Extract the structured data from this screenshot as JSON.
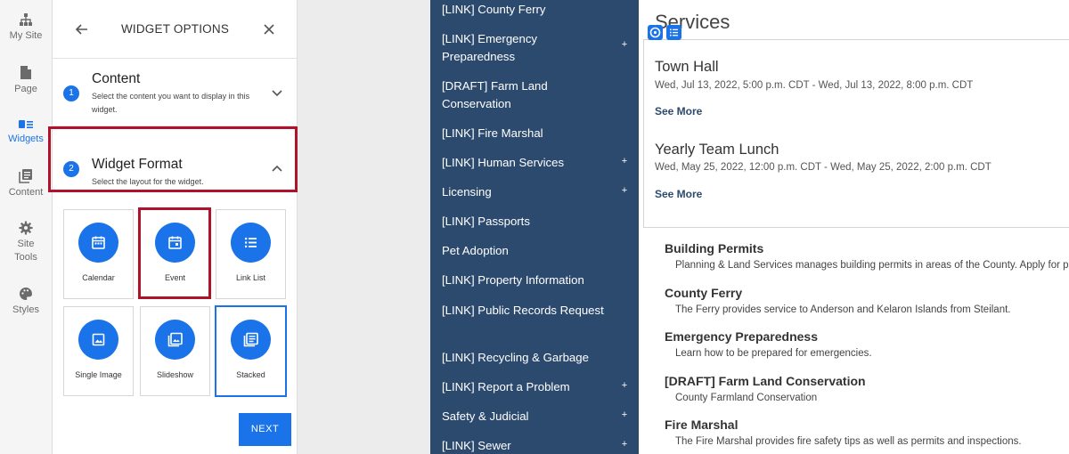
{
  "rail": {
    "items": [
      {
        "label": "My Site",
        "icon": "sitemap-icon"
      },
      {
        "label": "Page",
        "icon": "page-icon"
      },
      {
        "label": "Widgets",
        "icon": "widgets-icon"
      },
      {
        "label": "Content",
        "icon": "content-icon"
      },
      {
        "label": "Site Tools",
        "icon": "gear-icon"
      },
      {
        "label": "Styles",
        "icon": "palette-icon"
      }
    ],
    "active": "Widgets",
    "active_color": "#1a73e8"
  },
  "panel": {
    "title": "WIDGET OPTIONS",
    "steps": [
      {
        "num": "1",
        "title": "Content",
        "desc": "Select the content you want to display in this widget.",
        "state": "collapsed"
      },
      {
        "num": "2",
        "title": "Widget Format",
        "desc": "Select the layout for the widget.",
        "state": "expanded"
      }
    ],
    "formats": [
      {
        "label": "Calendar",
        "icon": "calendar-icon"
      },
      {
        "label": "Event",
        "icon": "event-icon"
      },
      {
        "label": "Link List",
        "icon": "list-icon"
      },
      {
        "label": "Single Image",
        "icon": "image-icon"
      },
      {
        "label": "Slideshow",
        "icon": "slideshow-icon"
      },
      {
        "label": "Stacked",
        "icon": "stacked-icon"
      }
    ],
    "selected_format": "Stacked",
    "next_label": "NEXT",
    "highlight_color": "#b0122b"
  },
  "nav": {
    "background": "#2c4a6e",
    "items": [
      {
        "label": "[LINK] County Ferry",
        "expandable": false
      },
      {
        "label": "[LINK] Emergency Preparedness",
        "expandable": true
      },
      {
        "label": "[DRAFT] Farm Land Conservation",
        "expandable": false
      },
      {
        "label": "[LINK] Fire Marshal",
        "expandable": false
      },
      {
        "label": "[LINK] Human Services",
        "expandable": true
      },
      {
        "label": "Licensing",
        "expandable": true
      },
      {
        "label": "[LINK] Passports",
        "expandable": false
      },
      {
        "label": "Pet Adoption",
        "expandable": false
      },
      {
        "label": "[LINK] Property Information",
        "expandable": false
      },
      {
        "label": "[LINK] Public Records Request",
        "expandable": false
      },
      {
        "label": "[LINK] Recycling & Garbage",
        "expandable": false
      },
      {
        "label": "[LINK] Report a Problem",
        "expandable": true
      },
      {
        "label": "Safety & Judicial",
        "expandable": true
      },
      {
        "label": "[LINK] Sewer",
        "expandable": true
      }
    ],
    "plus_symbol": "+"
  },
  "content": {
    "title": "Services",
    "events": [
      {
        "title": "Town Hall",
        "date": "Wed, Jul 13, 2022, 5:00 p.m. CDT - Wed, Jul 13, 2022, 8:00 p.m. CDT",
        "link": "See More"
      },
      {
        "title": "Yearly Team Lunch",
        "date": "Wed, May 25, 2022, 12:00 p.m. CDT - Wed, May 25, 2022, 2:00 p.m. CDT",
        "link": "See More"
      }
    ],
    "services": [
      {
        "name": "Building Permits",
        "desc": "Planning & Land Services manages building permits in areas of the County. Apply for p"
      },
      {
        "name": "County Ferry",
        "desc": "The Ferry provides service to Anderson and Kelaron Islands from Steilant."
      },
      {
        "name": "Emergency Preparedness",
        "desc": "Learn how to be prepared for emergencies."
      },
      {
        "name": "[DRAFT] Farm Land Conservation",
        "desc": "County Farmland Conservation"
      },
      {
        "name": "Fire Marshal",
        "desc": "The Fire Marshal provides fire safety tips as well as permits and inspections."
      }
    ]
  }
}
